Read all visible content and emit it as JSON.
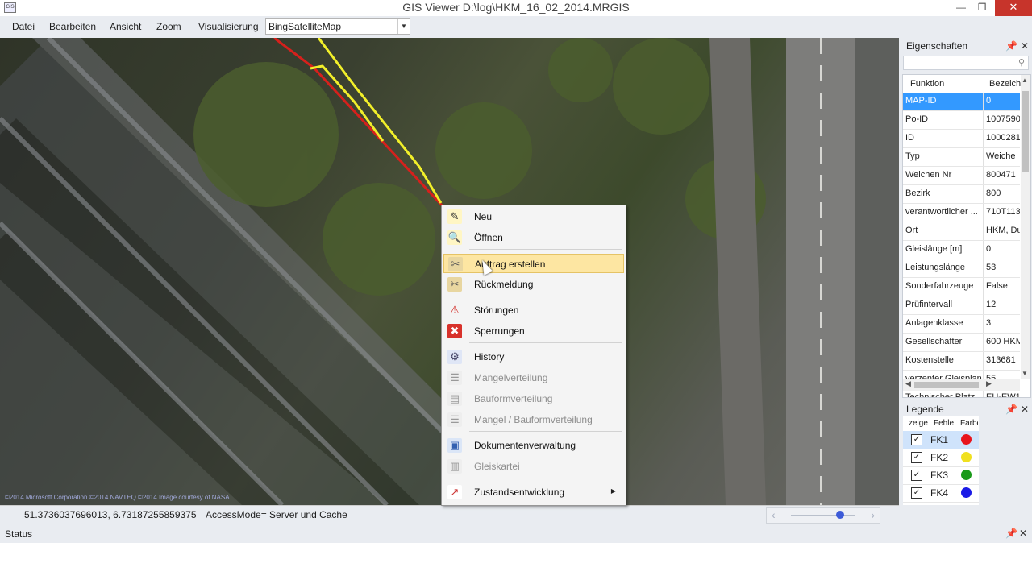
{
  "window": {
    "title": "GIS Viewer D:\\log\\HKM_16_02_2014.MRGIS",
    "minimize": "—",
    "maximize": "❐",
    "close": "✕"
  },
  "menu": {
    "datei": "Datei",
    "bearbeiten": "Bearbeiten",
    "ansicht": "Ansicht",
    "zoom": "Zoom",
    "visualisierung": "Visualisierung"
  },
  "map_select": {
    "value": "BingSatelliteMap"
  },
  "map": {
    "copyright": "©2014 Microsoft Corporation ©2014 NAVTEQ ©2014 Image courtesy of NASA"
  },
  "mapstatus": {
    "coords": "51.3736037696013, 6.73187255859375",
    "access": "AccessMode= Server und Cache",
    "zoom_left": "‹",
    "zoom_right": "›",
    "zoom_level": 0.8
  },
  "context_menu": {
    "items": [
      {
        "label": "Neu",
        "icon": "new-doc-icon",
        "enabled": true
      },
      {
        "label": "Öffnen",
        "icon": "open-doc-icon",
        "enabled": true
      },
      {
        "label": "Auftrag erstellen",
        "icon": "tools-icon",
        "enabled": true,
        "highlighted": true
      },
      {
        "label": "Rückmeldung",
        "icon": "feedback-tools-icon",
        "enabled": true
      },
      {
        "label": "Störungen",
        "icon": "warning-icon",
        "enabled": true
      },
      {
        "label": "Sperrungen",
        "icon": "block-icon",
        "enabled": true
      },
      {
        "label": "History",
        "icon": "history-icon",
        "enabled": true
      },
      {
        "label": "Mangelverteilung",
        "icon": "list-icon",
        "enabled": false
      },
      {
        "label": "Bauformverteilung",
        "icon": "bars-icon",
        "enabled": false
      },
      {
        "label": "Mangel / Bauformverteilung",
        "icon": "list-icon",
        "enabled": false
      },
      {
        "label": "Dokumentenverwaltung",
        "icon": "documents-icon",
        "enabled": true
      },
      {
        "label": "Gleiskartei",
        "icon": "card-icon",
        "enabled": false
      },
      {
        "label": "Zustandsentwicklung",
        "icon": "trend-chart-icon",
        "enabled": true,
        "submenu_arrow": "▶"
      }
    ]
  },
  "properties": {
    "title": "Eigenschaften",
    "col_function": "Funktion",
    "col_name": "Bezeich",
    "rows": [
      {
        "k": "MAP-ID",
        "v": "0"
      },
      {
        "k": "Po-ID",
        "v": "1007590"
      },
      {
        "k": "ID",
        "v": "1000281"
      },
      {
        "k": "Typ",
        "v": "Weiche"
      },
      {
        "k": "Weichen Nr",
        "v": "800471"
      },
      {
        "k": "Bezirk",
        "v": "800"
      },
      {
        "k": "verantwortlicher ...",
        "v": "710T113"
      },
      {
        "k": "Ort",
        "v": "HKM, Du"
      },
      {
        "k": "Gleislänge [m]",
        "v": "0"
      },
      {
        "k": "Leistungslänge",
        "v": "53"
      },
      {
        "k": "Sonderfahrzeuge",
        "v": "False"
      },
      {
        "k": "Prüfintervall",
        "v": "12"
      },
      {
        "k": "Anlagenklasse",
        "v": "3"
      },
      {
        "k": "Gesellschafter",
        "v": "600 HKM"
      },
      {
        "k": "Kostenstelle",
        "v": "313681"
      },
      {
        "k": "verzenter Gleisplan",
        "v": "55"
      },
      {
        "k": "Technischer Platz",
        "v": "EU-EW1"
      }
    ]
  },
  "legend": {
    "title": "Legende",
    "col_show": "zeige",
    "col_error": "Fehle",
    "col_color": "Farbe",
    "rows": [
      {
        "name": "FK1",
        "color": "#e8141c",
        "checked": true
      },
      {
        "name": "FK2",
        "color": "#f0e020",
        "checked": true
      },
      {
        "name": "FK3",
        "color": "#1a9a1a",
        "checked": true
      },
      {
        "name": "FK4",
        "color": "#1a1ae6",
        "checked": true
      }
    ]
  },
  "status": {
    "title": "Status"
  },
  "icons": {
    "pin": "📌",
    "close": "✕",
    "search": "⚲",
    "check": "✓",
    "up": "▲",
    "down": "▼",
    "left": "◀",
    "right": "▶"
  }
}
